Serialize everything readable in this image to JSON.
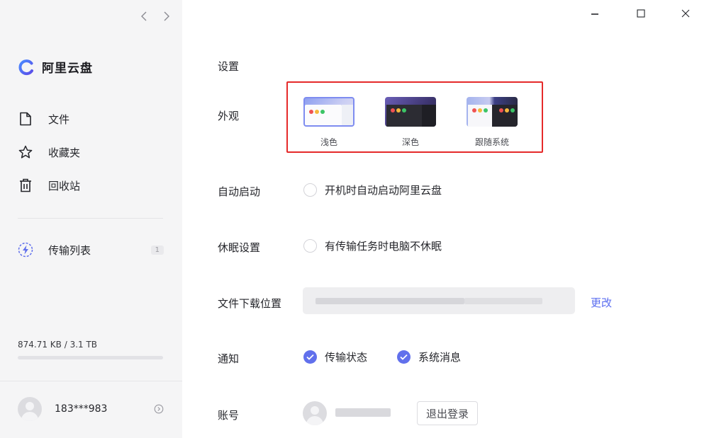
{
  "sidebar": {
    "nav_back": "<",
    "nav_forward": ">",
    "logo_text": "阿里云盘",
    "items": [
      {
        "label": "文件",
        "icon": "file-icon"
      },
      {
        "label": "收藏夹",
        "icon": "star-icon"
      },
      {
        "label": "回收站",
        "icon": "trash-icon"
      }
    ],
    "transfer": {
      "label": "传输列表",
      "icon": "lightning-icon",
      "badge": "1"
    },
    "storage": {
      "text": "874.71 KB / 3.1 TB",
      "used_fraction": 0.0
    },
    "user": {
      "name": "183***983",
      "icon": "right-circle-arrow-icon"
    }
  },
  "window": {
    "minimize": "minimize-icon",
    "maximize": "maximize-icon",
    "close": "close-icon"
  },
  "settings": {
    "title": "设置",
    "appearance": {
      "label": "外观",
      "themes": [
        {
          "label": "浅色",
          "key": "light"
        },
        {
          "label": "深色",
          "key": "dark"
        },
        {
          "label": "跟随系统",
          "key": "system"
        }
      ],
      "selected": "light"
    },
    "autostart": {
      "label": "自动启动",
      "option": "开机时自动启动阿里云盘",
      "checked": false
    },
    "sleep": {
      "label": "休眠设置",
      "option": "有传输任务时电脑不休眠",
      "checked": false
    },
    "download": {
      "label": "文件下载位置",
      "change_label": "更改"
    },
    "notify": {
      "label": "通知",
      "options": [
        {
          "label": "传输状态",
          "checked": true
        },
        {
          "label": "系统消息",
          "checked": true
        }
      ]
    },
    "account": {
      "label": "账号",
      "logout_label": "退出登录"
    }
  },
  "colors": {
    "accent": "#6170ec",
    "link": "#5b6ef0",
    "highlight_border": "#e52a2a",
    "sidebar_bg": "#f5f5f6"
  }
}
